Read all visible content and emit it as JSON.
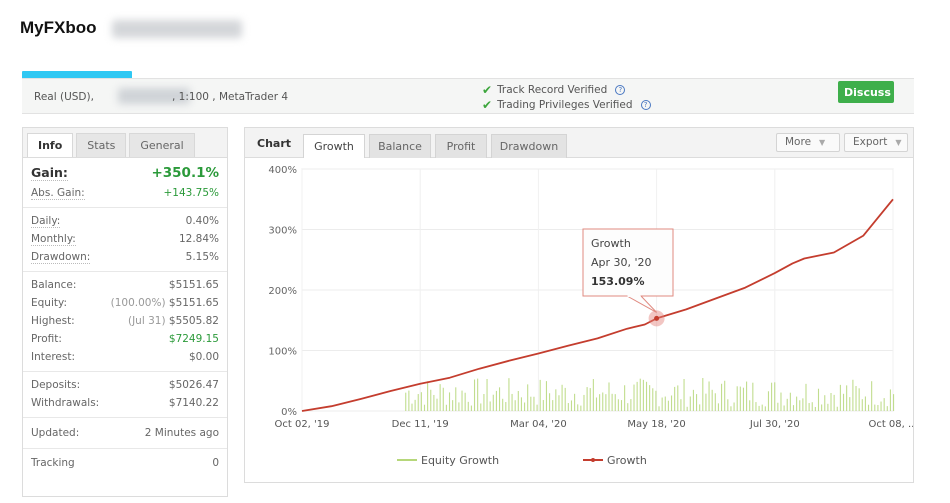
{
  "header": {
    "title": "MyFXboo"
  },
  "account": {
    "type": "Real (USD),",
    "leverage": ", 1:100 , MetaTrader 4",
    "track_record": "Track Record Verified",
    "trading_privileges": "Trading Privileges Verified",
    "discuss_label": "Discuss",
    "accent_color": "#3eaf4b",
    "info_icon": "?"
  },
  "left_tabs": {
    "info": "Info",
    "stats": "Stats",
    "general": "General"
  },
  "stats": {
    "gain_label": "Gain:",
    "gain_value": "+350.1%",
    "abs_gain_label": "Abs. Gain:",
    "abs_gain_value": "+143.75%",
    "daily_label": "Daily:",
    "daily_value": "0.40%",
    "monthly_label": "Monthly:",
    "monthly_value": "12.84%",
    "drawdown_label": "Drawdown:",
    "drawdown_value": "5.15%",
    "balance_label": "Balance:",
    "balance_value": "$5151.65",
    "equity_label": "Equity:",
    "equity_pct": "(100.00%)",
    "equity_value": "$5151.65",
    "highest_label": "Highest:",
    "highest_date": "(Jul 31)",
    "highest_value": "$5505.82",
    "profit_label": "Profit:",
    "profit_value": "$7249.15",
    "interest_label": "Interest:",
    "interest_value": "$0.00",
    "deposits_label": "Deposits:",
    "deposits_value": "$5026.47",
    "withdrawals_label": "Withdrawals:",
    "withdrawals_value": "$7140.22",
    "updated_label": "Updated:",
    "updated_value": "2 Minutes ago",
    "tracking_label": "Tracking",
    "tracking_value": "0"
  },
  "chart_tabs": {
    "chart": "Chart",
    "growth": "Growth",
    "balance": "Balance",
    "profit": "Profit",
    "drawdown": "Drawdown",
    "more": "More",
    "export": "Export"
  },
  "chart_data": {
    "type": "line",
    "x_tick_labels": [
      "Oct 02, '19",
      "Dec 11, '19",
      "Mar 04, '20",
      "May 18, '20",
      "Jul 30, '20",
      "Oct 08, ..."
    ],
    "y_tick_labels": [
      "0%",
      "100%",
      "200%",
      "300%",
      "400%"
    ],
    "ylim": [
      0,
      400
    ],
    "grid": true,
    "legend": [
      "Equity Growth",
      "Growth"
    ],
    "legend_position": "bottom",
    "series": [
      {
        "name": "Growth",
        "color": "#c43d2e",
        "x": [
          0,
          0.05,
          0.1,
          0.15,
          0.2,
          0.25,
          0.3,
          0.35,
          0.4,
          0.45,
          0.5,
          0.55,
          0.58,
          0.6,
          0.65,
          0.7,
          0.75,
          0.8,
          0.83,
          0.85,
          0.88,
          0.9,
          0.95,
          1.0
        ],
        "values": [
          0,
          8,
          20,
          33,
          45,
          55,
          70,
          83,
          95,
          108,
          120,
          136,
          143,
          153,
          168,
          186,
          204,
          228,
          244,
          252,
          258,
          262,
          290,
          350
        ]
      },
      {
        "name": "Equity Growth",
        "color": "#b6d77a"
      }
    ],
    "tooltip": {
      "series": "Growth",
      "date": "Apr 30, '20",
      "value": "153.09%"
    }
  }
}
